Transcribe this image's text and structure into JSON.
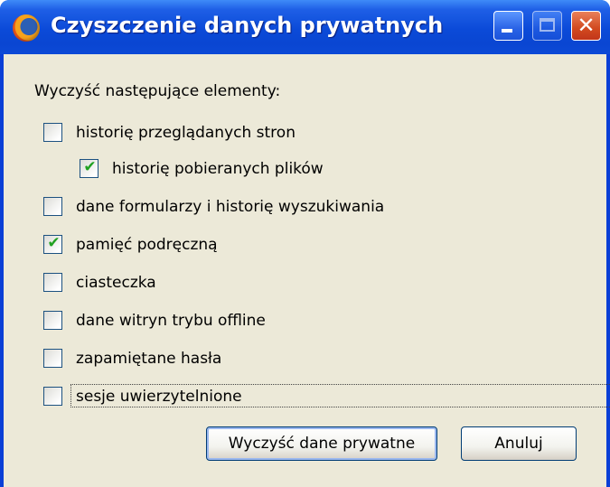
{
  "window": {
    "title": "Czyszczenie danych prywatnych",
    "app_icon": "firefox-icon",
    "caption_buttons": [
      "minimize-icon",
      "maximize-icon",
      "close-icon"
    ],
    "colors": {
      "titlebar": "#0a46d2",
      "client": "#ece9d8",
      "close_button": "#d24a1f",
      "checkmark": "#21a121"
    }
  },
  "dialog": {
    "heading": "Wyczyść następujące elementy:",
    "items": [
      {
        "label": "historię przeglądanych stron",
        "checked": false,
        "indented": false
      },
      {
        "label": "historię pobieranych plików",
        "checked": true,
        "indented": true
      },
      {
        "label": "dane formularzy i historię wyszukiwania",
        "checked": false,
        "indented": false
      },
      {
        "label": "pamięć podręczną",
        "checked": true,
        "indented": false
      },
      {
        "label": "ciasteczka",
        "checked": false,
        "indented": false
      },
      {
        "label": "dane witryn trybu offline",
        "checked": false,
        "indented": false
      },
      {
        "label": "zapamiętane hasła",
        "checked": false,
        "indented": false
      },
      {
        "label": "sesje uwierzytelnione",
        "checked": false,
        "indented": false,
        "focused": true
      }
    ],
    "clear_button": "Wyczyść dane prywatne",
    "cancel_button": "Anuluj"
  }
}
